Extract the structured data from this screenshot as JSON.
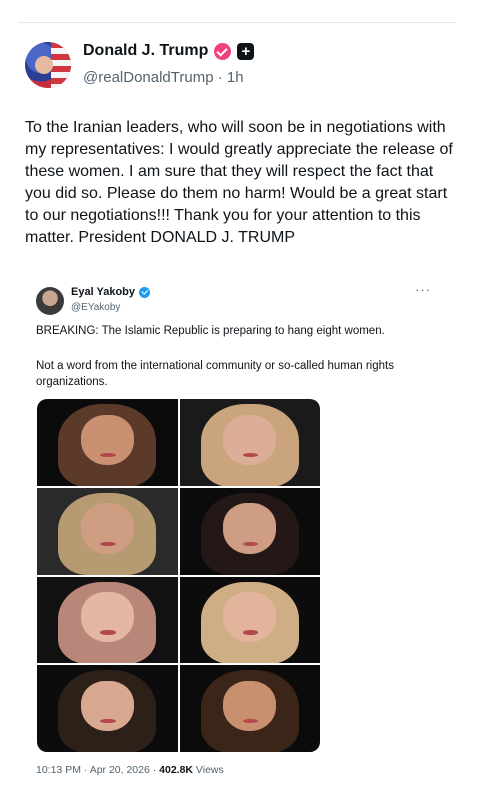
{
  "author": {
    "name": "Donald J. Trump",
    "handle": "@realDonaldTrump",
    "time": "1h"
  },
  "tweet": {
    "text": "To the Iranian leaders, who will soon be in negotiations with my representatives: I would greatly appreciate the release of these women. I am sure that they will respect the fact that you did so. Please do them no harm! Would be a great start to our negotiations!!! Thank you for your attention to this matter. President DONALD J. TRUMP"
  },
  "quoted": {
    "name": "Eyal Yakoby",
    "handle": "@EYakoby",
    "more": "···",
    "text1": "BREAKING: The Islamic Republic is preparing to hang eight women.",
    "text2": "Not a word from the international community or so-called human rights organizations.",
    "timestamp": "10:13 PM · Apr 20, 2026 · ",
    "views_count": "402.8K",
    "views_label": " Views",
    "photos": [
      {
        "hair": "#5b3a2a",
        "skin": "#c99072",
        "bg": "#0b0b0b"
      },
      {
        "hair": "#c9a47c",
        "skin": "#dcae98",
        "bg": "#1a1a1a"
      },
      {
        "hair": "#b59a72",
        "skin": "#cf9d82",
        "bg": "#2a2a2a"
      },
      {
        "hair": "#231815",
        "skin": "#cf9c84",
        "bg": "#0b0b0b"
      },
      {
        "hair": "#b9867a",
        "skin": "#e3b7a4",
        "bg": "#111111"
      },
      {
        "hair": "#cfae86",
        "skin": "#e2b49c",
        "bg": "#0c0c0c"
      },
      {
        "hair": "#2d2019",
        "skin": "#d9a890",
        "bg": "#0c0c0c"
      },
      {
        "hair": "#3b2519",
        "skin": "#c9906f",
        "bg": "#0b0b0b"
      }
    ]
  }
}
